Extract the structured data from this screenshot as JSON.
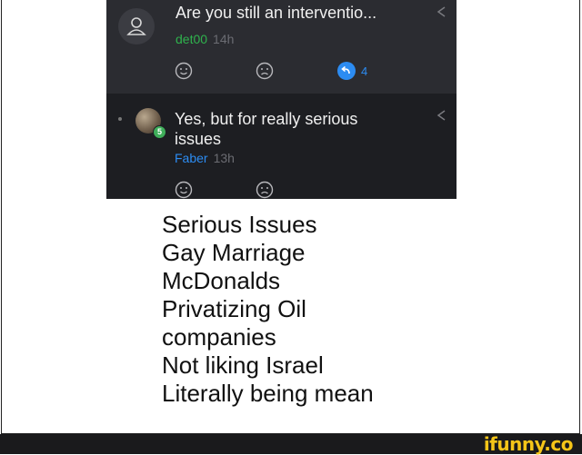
{
  "comments": [
    {
      "text": "Are you still an interventio...",
      "username": "det00",
      "time": "14h",
      "reply_count": "4",
      "colors": {
        "username": "#2fb24d"
      },
      "icons": [
        "user-silhouette-icon",
        "smile-icon",
        "frown-icon",
        "reply-icon",
        "share-icon"
      ]
    },
    {
      "text": "Yes, but for really serious issues",
      "username": "Faber",
      "time": "13h",
      "level_badge": "5",
      "colors": {
        "username": "#2c8cf2"
      },
      "icons": [
        "avatar-image",
        "smile-icon",
        "frown-icon",
        "share-icon"
      ]
    }
  ],
  "caption_lines": [
    "Serious Issues",
    "Gay Marriage",
    "McDonalds",
    "Privatizing Oil",
    "companies",
    "Not liking Israel",
    "Literally being mean"
  ],
  "watermark": "ifunny.co",
  "colors": {
    "panel_top": "#2b2c31",
    "panel_bottom": "#1d1e22",
    "watermark": "#f5c518"
  }
}
